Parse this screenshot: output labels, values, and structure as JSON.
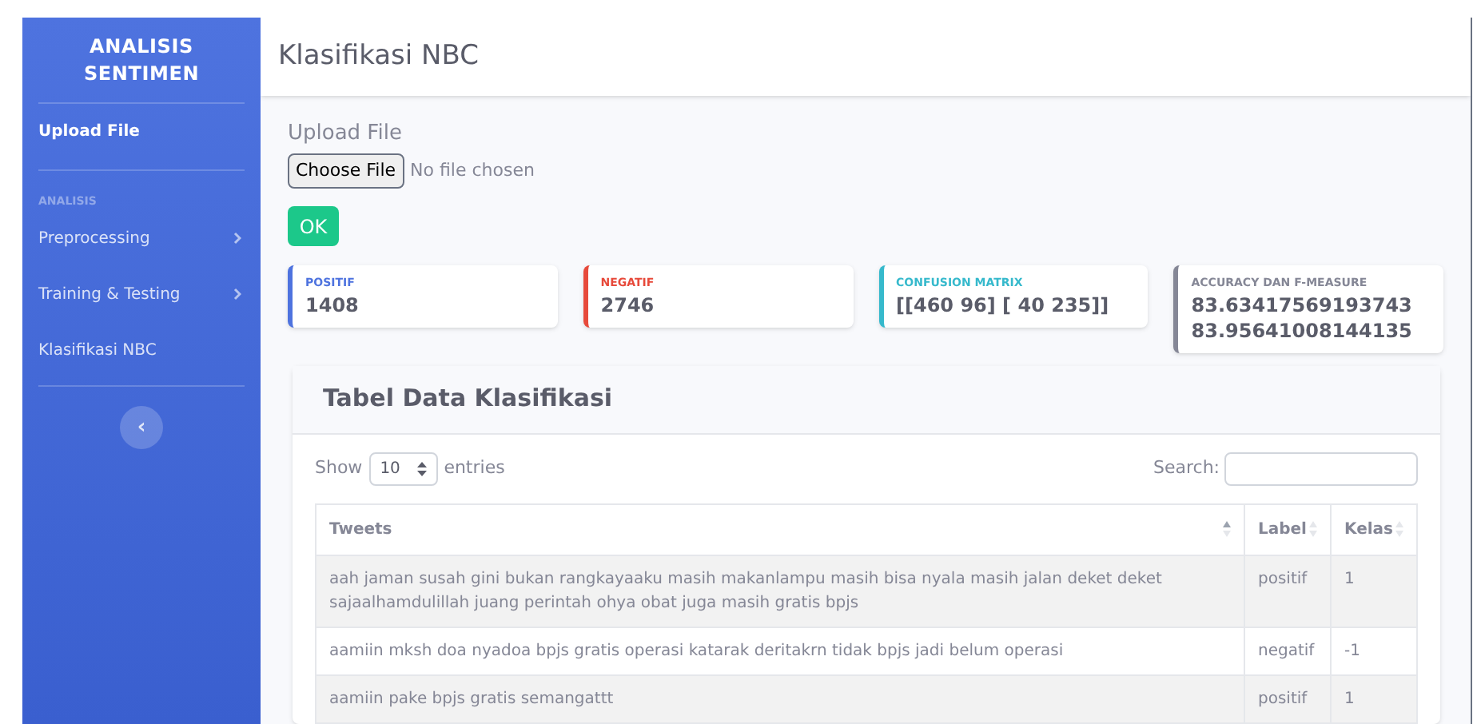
{
  "sidebar": {
    "brand": [
      "ANALISIS",
      "SENTIMEN"
    ],
    "items": [
      {
        "label": "Upload File",
        "kind": "link",
        "selected": true
      },
      {
        "label": "Preprocessing",
        "kind": "submenu",
        "selected": false,
        "section": "ANALISIS"
      },
      {
        "label": "Training & Testing",
        "kind": "submenu",
        "selected": false
      },
      {
        "label": "Klasifikasi NBC",
        "kind": "link",
        "selected": false
      }
    ],
    "toggle": "‹"
  },
  "topbar": {
    "title": "Klasifikasi NBC"
  },
  "upload": {
    "heading": "Upload File",
    "file_button": "Choose File",
    "file_status": "No file chosen",
    "submit": "OK"
  },
  "cards": [
    {
      "title": "POSITIF",
      "values": [
        "1408"
      ],
      "color": "#4e73df"
    },
    {
      "title": "NEGATIF",
      "values": [
        "2746"
      ],
      "color": "#e74a3b"
    },
    {
      "title": "CONFUSION MATRIX",
      "values": [
        "[[460 96] [ 40 235]]"
      ],
      "color": "#36b9cc"
    },
    {
      "title": "ACCURACY DAN F-MEASURE",
      "values": [
        "83.63417569193743",
        "83.95641008144135"
      ],
      "color": "#858796"
    }
  ],
  "table_card": {
    "title": "Tabel Data Klasifikasi",
    "show_label": "Show",
    "page_size": "10",
    "entries_label": "entries",
    "search_label": "Search:",
    "columns": [
      {
        "label": "Tweets",
        "sorted": true
      },
      {
        "label": "Label",
        "sorted": false
      },
      {
        "label": "Kelas",
        "sorted": false
      }
    ],
    "rows": [
      [
        "aah jaman susah gini bukan rangkayaaku masih makanlampu masih bisa nyala masih jalan deket deket sajaalhamdulillah juang perintah ohya obat juga masih gratis bpjs",
        "positif",
        "1"
      ],
      [
        "aamiin mksh doa nyadoa bpjs gratis operasi katarak deritakrn tidak bpjs jadi belum operasi",
        "negatif",
        "-1"
      ],
      [
        "aamiin pake bpjs gratis semangattt",
        "positif",
        "1"
      ]
    ]
  }
}
